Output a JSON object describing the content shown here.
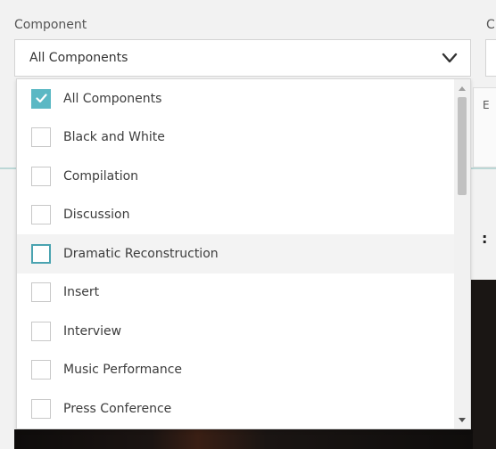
{
  "component_filter": {
    "label": "Component",
    "selected": "All Components",
    "options": [
      {
        "label": "All Components",
        "checked": true
      },
      {
        "label": "Black and White",
        "checked": false
      },
      {
        "label": "Compilation",
        "checked": false
      },
      {
        "label": "Discussion",
        "checked": false
      },
      {
        "label": "Dramatic Reconstruction",
        "checked": false
      },
      {
        "label": "Insert",
        "checked": false
      },
      {
        "label": "Interview",
        "checked": false
      },
      {
        "label": "Music Performance",
        "checked": false
      },
      {
        "label": "Press Conference",
        "checked": false
      }
    ]
  },
  "adjacent_filter": {
    "label_fragment": "C"
  },
  "icons": {
    "dropdown": "chevron-down-icon",
    "check": "checkmark-icon",
    "scroll_up": "scroll-up-arrow-icon",
    "scroll_down": "scroll-down-arrow-icon"
  },
  "colors": {
    "checkbox_checked": "#5bb8c4",
    "checkbox_focus_border": "#4aa3b0",
    "hover_row": "#f3f3f3"
  }
}
